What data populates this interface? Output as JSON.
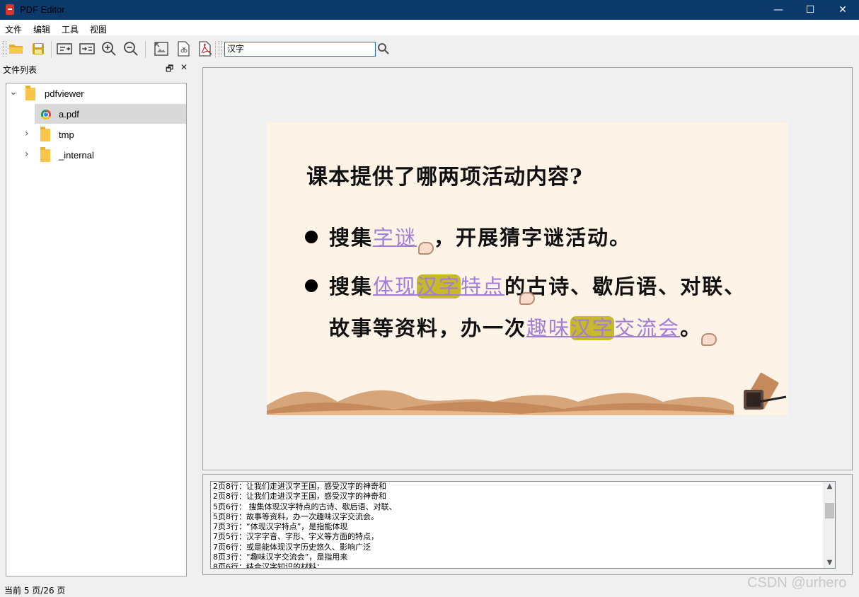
{
  "window": {
    "title": "PDF Editor",
    "minimize": "—",
    "maximize": "☐",
    "close": "✕"
  },
  "menu": [
    "文件",
    "编辑",
    "工具",
    "视图"
  ],
  "toolbar": {
    "search_value": "汉字",
    "icons": [
      "open-folder-icon",
      "save-icon",
      "text-extract-left-icon",
      "text-extract-right-icon",
      "zoom-in-icon",
      "zoom-out-icon",
      "image-extract-icon",
      "split-icon",
      "pdf-convert-icon",
      "search-icon"
    ]
  },
  "dock": {
    "title": "文件列表",
    "float": "🗗",
    "close": "✕"
  },
  "tree": [
    {
      "label": "pdfviewer",
      "expanded": true,
      "chevron": "⌄"
    },
    {
      "label": "a.pdf",
      "selected": true
    },
    {
      "label": "tmp",
      "chevron": "›"
    },
    {
      "label": "_internal",
      "chevron": "›"
    }
  ],
  "slide": {
    "question": "课本提供了哪两项活动内容?",
    "l1_a": "搜集",
    "l1_link": "字谜",
    "l1_b": "，开展猜字谜活动。",
    "l2_a": "搜集",
    "l2_link_a": "体现",
    "l2_hl": "汉字",
    "l2_link_b": "特点",
    "l2_b": "的古诗、歇后语、对联、",
    "l3_a": "故事等资料，办一次",
    "l3_link_a": "趣味",
    "l3_hl": "汉字",
    "l3_link_b": "交流会",
    "l3_b": "。",
    "colors": {
      "bg": "#fdf3e7",
      "link": "#a27ed9",
      "highlight": "#c7b92a"
    }
  },
  "results": [
    "2页8行：让我们走进汉字王国，感受汉字的神奇和",
    "2页8行：让我们走进汉字王国，感受汉字的神奇和",
    "5页6行：    搜集体现汉字特点的古诗、歇后语、对联、",
    "5页8行：故事等资料，办一次趣味汉字交流会。",
    "7页3行：“体现汉字特点”，是指能体现",
    "7页5行：汉字字音、字形、字义等方面的特点，",
    "7页6行：或是能体现汉字历史悠久、影响广泛",
    "8页3行：“趣味汉字交流会”，是指用来",
    "8页6行：结合汉字知识的材料；"
  ],
  "status": "当前 5 页/26 页",
  "watermark": "CSDN @urhero"
}
